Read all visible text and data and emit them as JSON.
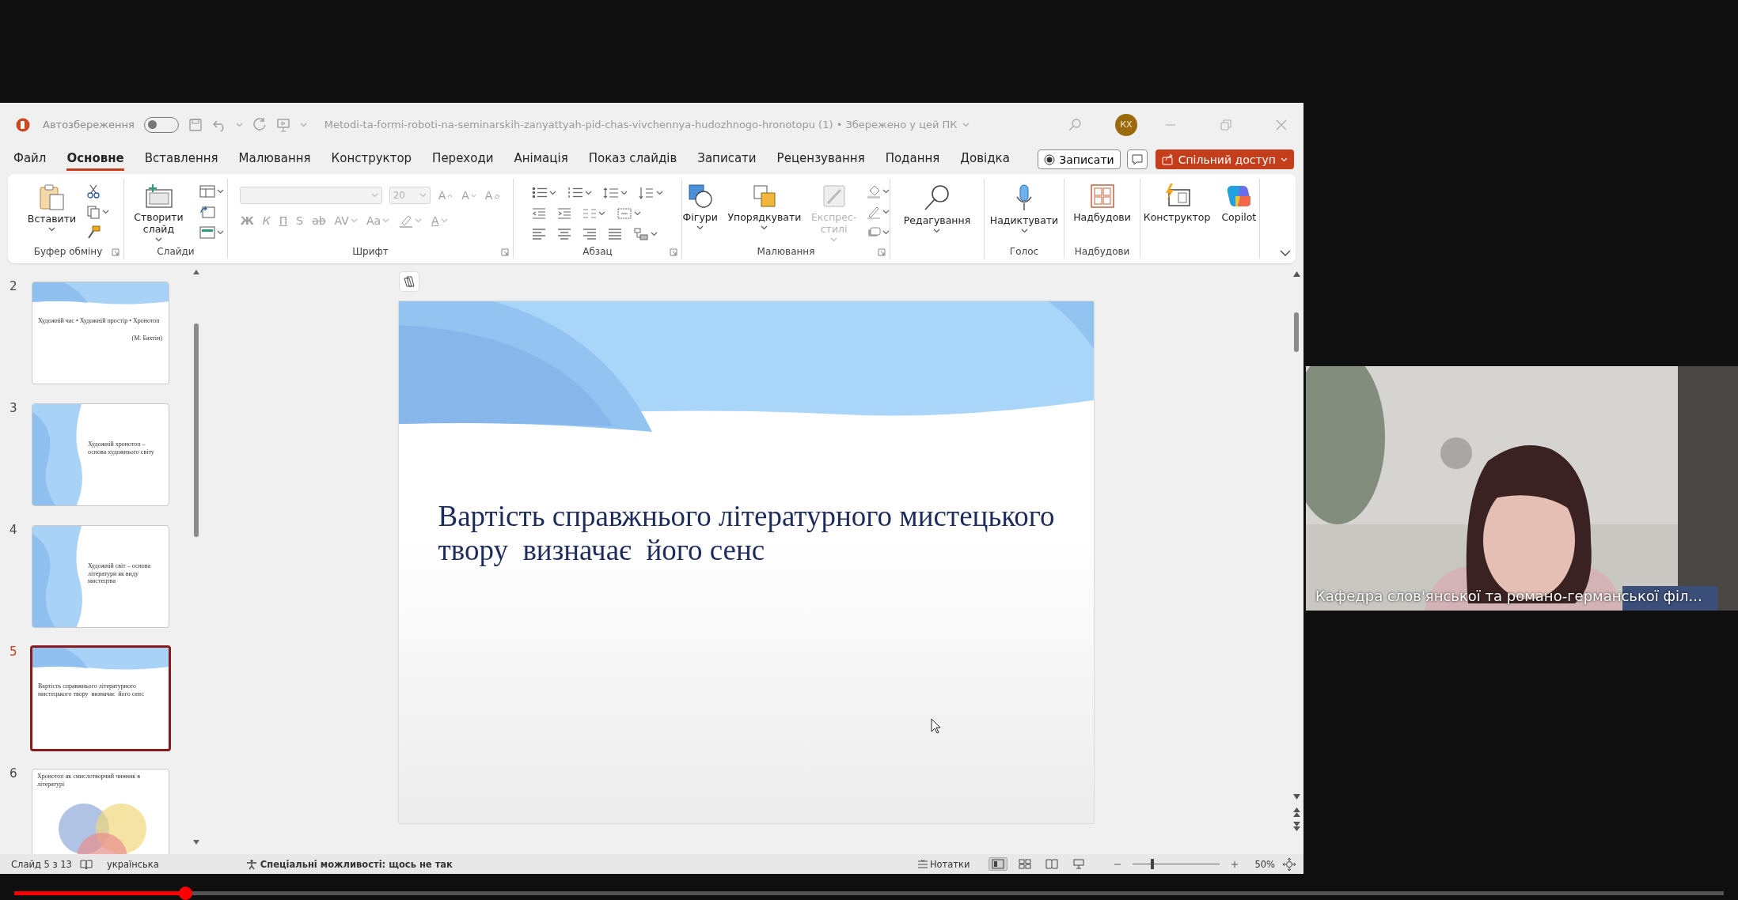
{
  "title_bar": {
    "autosave_label": "Автозбереження",
    "autosave_on": false,
    "document_title": "Metodi-ta-formi-roboti-na-seminarskih-zanyattyah-pid-chas-vivchennya-hudozhnogo-hronotopu (1) • Збережено у цей ПК",
    "avatar_initials": "КХ"
  },
  "tabs": [
    {
      "label": "Файл",
      "selected": false
    },
    {
      "label": "Основне",
      "selected": true
    },
    {
      "label": "Вставлення",
      "selected": false
    },
    {
      "label": "Малювання",
      "selected": false
    },
    {
      "label": "Конструктор",
      "selected": false
    },
    {
      "label": "Переходи",
      "selected": false
    },
    {
      "label": "Анімація",
      "selected": false
    },
    {
      "label": "Показ слайдів",
      "selected": false
    },
    {
      "label": "Записати",
      "selected": false
    },
    {
      "label": "Рецензування",
      "selected": false
    },
    {
      "label": "Подання",
      "selected": false
    },
    {
      "label": "Довідка",
      "selected": false
    }
  ],
  "record_button": "Записати",
  "share_button": "Спільний доступ",
  "ribbon": {
    "groups": [
      {
        "label": "Буфер обміну",
        "launcher": true,
        "buttons": [
          {
            "label": "Вставити",
            "disabled": false,
            "dropdown": true
          }
        ]
      },
      {
        "label": "Слайди",
        "launcher": false,
        "buttons": [
          {
            "label": "Створити слайд",
            "disabled": false,
            "dropdown": true
          }
        ]
      },
      {
        "label": "Шрифт",
        "launcher": true,
        "disabled": true,
        "font_size": "20",
        "size_letters": [
          "A",
          "A",
          "A"
        ],
        "format_letters": [
          "Ж",
          "К",
          "П",
          "S",
          "ab",
          "AV",
          "Aa"
        ],
        "color_letter": "A"
      },
      {
        "label": "Абзац",
        "launcher": true
      },
      {
        "label": "Малювання",
        "launcher": true,
        "buttons": [
          {
            "label": "Фігури",
            "disabled": false,
            "dropdown": true
          },
          {
            "label": "Упорядкувати",
            "disabled": false,
            "dropdown": true
          },
          {
            "label": "Експрес-стилі",
            "disabled": true,
            "dropdown": true
          }
        ]
      },
      {
        "launcher": false,
        "buttons": [
          {
            "label": "Редагування",
            "disabled": false,
            "dropdown": true
          }
        ]
      },
      {
        "label": "Голос",
        "launcher": false,
        "buttons": [
          {
            "label": "Надиктувати",
            "disabled": false,
            "dropdown": true
          }
        ]
      },
      {
        "label": "Надбудови",
        "launcher": false,
        "buttons": [
          {
            "label": "Надбудови",
            "disabled": false,
            "dropdown": false
          }
        ]
      },
      {
        "launcher": false,
        "buttons": [
          {
            "label": "Конструктор",
            "disabled": false,
            "dropdown": false
          },
          {
            "label": "Copilot",
            "disabled": false,
            "dropdown": false
          }
        ]
      }
    ]
  },
  "thumbnails": [
    {
      "number": "2",
      "kind": "header-wave",
      "selected": false,
      "text": "Художній час • Художній простір • Хронотоп",
      "note": "(М. Бахтін)"
    },
    {
      "number": "3",
      "kind": "side-wave",
      "selected": false,
      "text": "Художній хронотоп – основа художнього світу"
    },
    {
      "number": "4",
      "kind": "side-wave",
      "selected": false,
      "text": "Художній світ – основа літератури як виду мистецтва"
    },
    {
      "number": "5",
      "kind": "header-wave",
      "selected": true,
      "text": "Вартість справжнього літературного мистецького твору  визначає  його сенс"
    },
    {
      "number": "6",
      "kind": "venn",
      "selected": false,
      "text": "Хронотоп як смислотворчий чинник в літературі"
    }
  ],
  "slide": {
    "title": "Вартість справжнього літературного мистецького твору  визначає  його сенс"
  },
  "status_bar": {
    "slide_counter": "Слайд 5 з 13",
    "language": "українська",
    "accessibility": "Спеціальні можливості: щось не так",
    "notes": "Нотатки",
    "views": [
      {
        "selected": true
      },
      {
        "selected": false
      },
      {
        "selected": false
      },
      {
        "selected": false
      }
    ],
    "zoom": {
      "level": 0.22,
      "reading": "50%"
    }
  },
  "webcam": {
    "kind": "picture",
    "caption": "Кафедра слов'янської та романо-германської філ..."
  },
  "video_progress": {
    "level": 0.1
  }
}
